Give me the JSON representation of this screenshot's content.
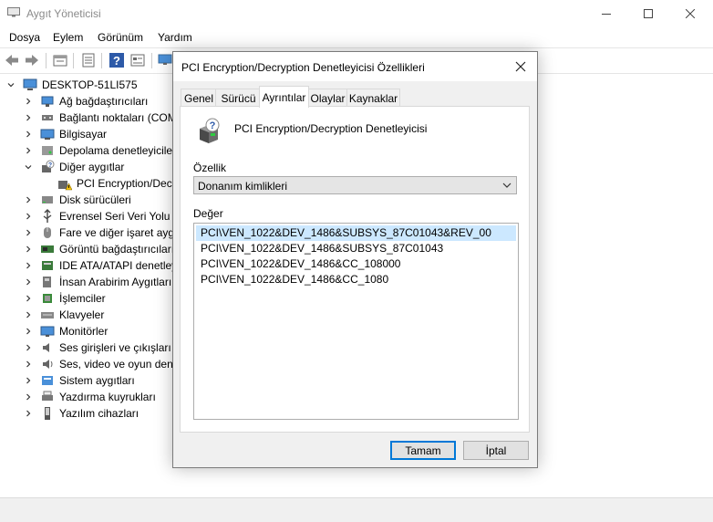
{
  "window": {
    "title": "Aygıt Yöneticisi",
    "controls": {
      "minimize": "—",
      "maximize": "☐",
      "close": "✕"
    }
  },
  "menu": [
    "Dosya",
    "Eylem",
    "Görünüm",
    "Yardım"
  ],
  "toolbar": [
    "back-icon",
    "forward-icon",
    "properties-icon",
    "list-icon",
    "help-icon",
    "view-icon",
    "monitor-icon"
  ],
  "tree": {
    "root": "DESKTOP-51LI575",
    "items": [
      {
        "label": "Ağ bağdaştırıcıları",
        "icon": "network-adapter-icon",
        "expanded": false
      },
      {
        "label": "Bağlantı noktaları (COM",
        "icon": "ports-icon",
        "expanded": false
      },
      {
        "label": "Bilgisayar",
        "icon": "computer-icon",
        "expanded": false
      },
      {
        "label": "Depolama denetleyiciler",
        "icon": "storage-icon",
        "expanded": false
      },
      {
        "label": "Diğer aygıtlar",
        "icon": "other-devices-icon",
        "expanded": true
      },
      {
        "label": "PCI Encryption/Decr",
        "icon": "warning-device-icon",
        "child": true
      },
      {
        "label": "Disk sürücüleri",
        "icon": "disk-icon",
        "expanded": false
      },
      {
        "label": "Evrensel Seri Veri Yolu de",
        "icon": "usb-icon",
        "expanded": false
      },
      {
        "label": "Fare ve diğer işaret aygıt",
        "icon": "mouse-icon",
        "expanded": false
      },
      {
        "label": "Görüntü bağdaştırıcıları",
        "icon": "display-adapter-icon",
        "expanded": false
      },
      {
        "label": "IDE ATA/ATAPI denetleyi",
        "icon": "ide-icon",
        "expanded": false
      },
      {
        "label": "İnsan Arabirim Aygıtları",
        "icon": "hid-icon",
        "expanded": false
      },
      {
        "label": "İşlemciler",
        "icon": "processor-icon",
        "expanded": false
      },
      {
        "label": "Klavyeler",
        "icon": "keyboard-icon",
        "expanded": false
      },
      {
        "label": "Monitörler",
        "icon": "monitor-icon",
        "expanded": false
      },
      {
        "label": "Ses girişleri ve çıkışları",
        "icon": "audio-io-icon",
        "expanded": false
      },
      {
        "label": "Ses, video ve oyun dene",
        "icon": "sound-icon",
        "expanded": false
      },
      {
        "label": "Sistem aygıtları",
        "icon": "system-devices-icon",
        "expanded": false
      },
      {
        "label": "Yazdırma kuyrukları",
        "icon": "printer-icon",
        "expanded": false
      },
      {
        "label": "Yazılım cihazları",
        "icon": "software-device-icon",
        "expanded": false
      }
    ]
  },
  "dialog": {
    "title": "PCI Encryption/Decryption Denetleyicisi Özellikleri",
    "tabs": [
      "Genel",
      "Sürücü",
      "Ayrıntılar",
      "Olaylar",
      "Kaynaklar"
    ],
    "active_tab": "Ayrıntılar",
    "device_name": "PCI Encryption/Decryption Denetleyicisi",
    "property_label": "Özellik",
    "property_value": "Donanım kimlikleri",
    "value_label": "Değer",
    "values": [
      "PCI\\VEN_1022&DEV_1486&SUBSYS_87C01043&REV_00",
      "PCI\\VEN_1022&DEV_1486&SUBSYS_87C01043",
      "PCI\\VEN_1022&DEV_1486&CC_108000",
      "PCI\\VEN_1022&DEV_1486&CC_1080"
    ],
    "selected_value_index": 0,
    "ok_label": "Tamam",
    "cancel_label": "İptal"
  },
  "colors": {
    "selection": "#cce8ff",
    "accent": "#0078d7",
    "dialog_bg": "#f0f0f0"
  }
}
